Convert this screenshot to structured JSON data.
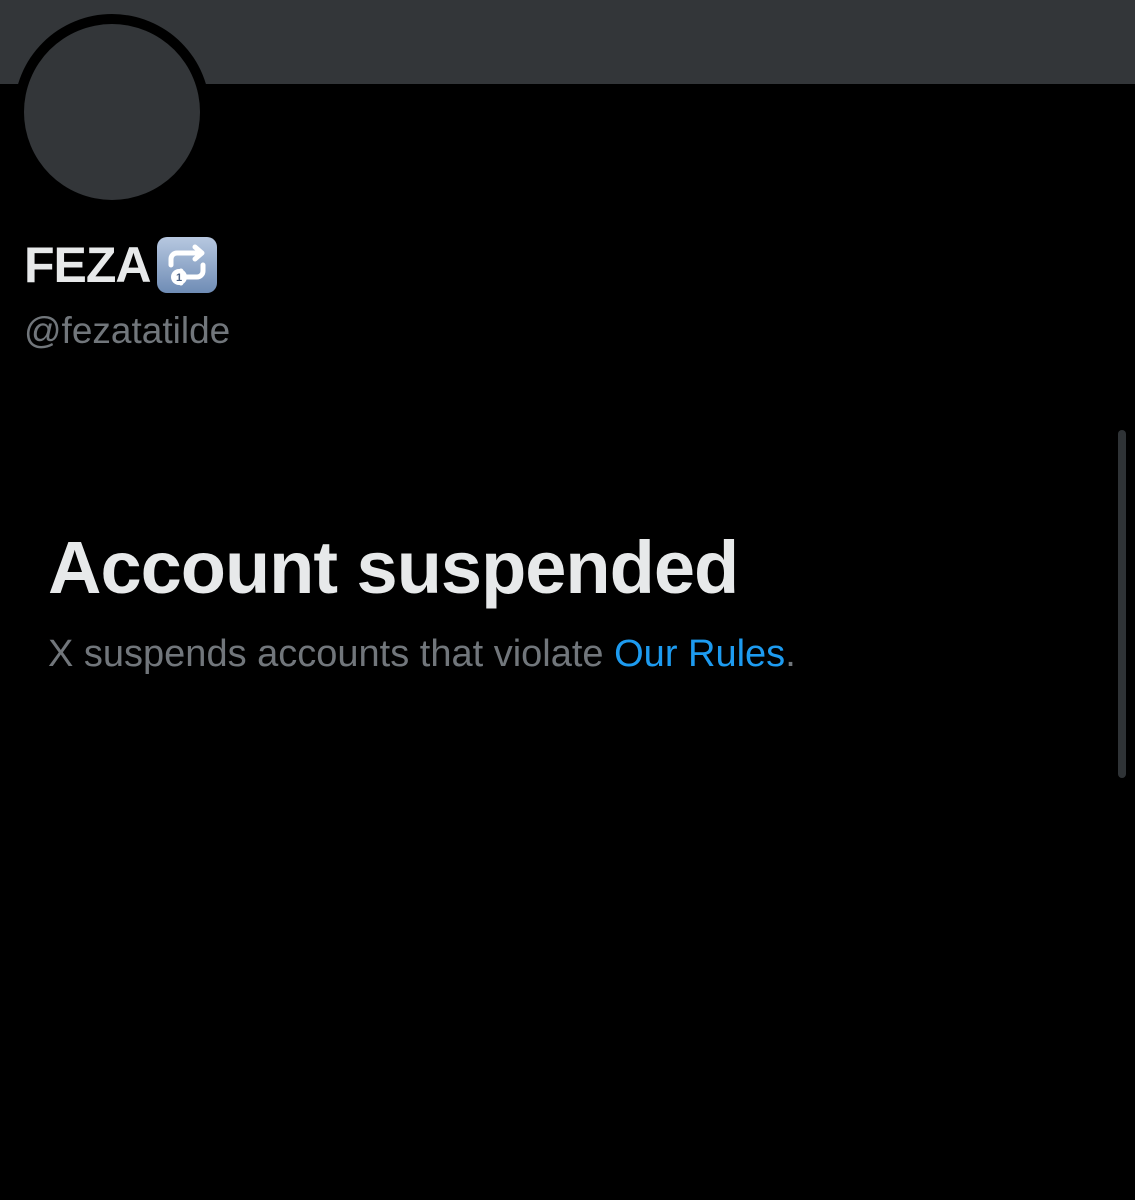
{
  "profile": {
    "display_name": "FEZA",
    "name_emoji_icon": "repeat-single-button-icon",
    "handle": "@fezatatilde"
  },
  "suspension": {
    "title": "Account suspended",
    "message_prefix": "X suspends accounts that violate ",
    "rules_link_label": "Our Rules",
    "message_suffix": "."
  },
  "colors": {
    "background": "#000000",
    "banner": "#333639",
    "primary_text": "#e7e9ea",
    "secondary_text": "#71767b",
    "link": "#1d9bf0",
    "emoji_tile": "#8ba3c7"
  }
}
